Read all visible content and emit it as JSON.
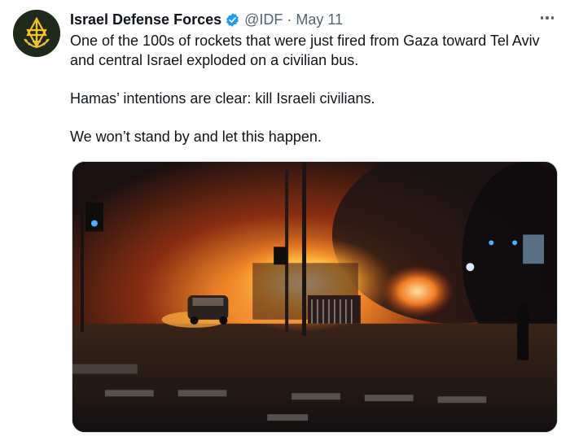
{
  "tweet": {
    "author": {
      "display_name": "Israel Defense Forces",
      "handle": "@IDF",
      "verified": true,
      "avatar_icon": "idf-emblem-icon",
      "avatar_colors": {
        "background": "#1f2a1c",
        "emblem": "#f2c230"
      }
    },
    "separator": "·",
    "date": "May 11",
    "more_icon": "more-options-icon",
    "text_lines": [
      "One of the 100s of rockets that were just fired from Gaza toward Tel Aviv",
      "and central Israel exploded on a civilian bus.",
      "Hamas’ intentions are clear: kill Israeli civilians.",
      "We won’t stand by and let this happen."
    ],
    "media": {
      "icon": "burning-bus-photo"
    }
  },
  "colors": {
    "text_primary": "#0f1419",
    "text_secondary": "#536471",
    "verified_blue": "#1d9bf0",
    "border": "#cfd9de"
  }
}
